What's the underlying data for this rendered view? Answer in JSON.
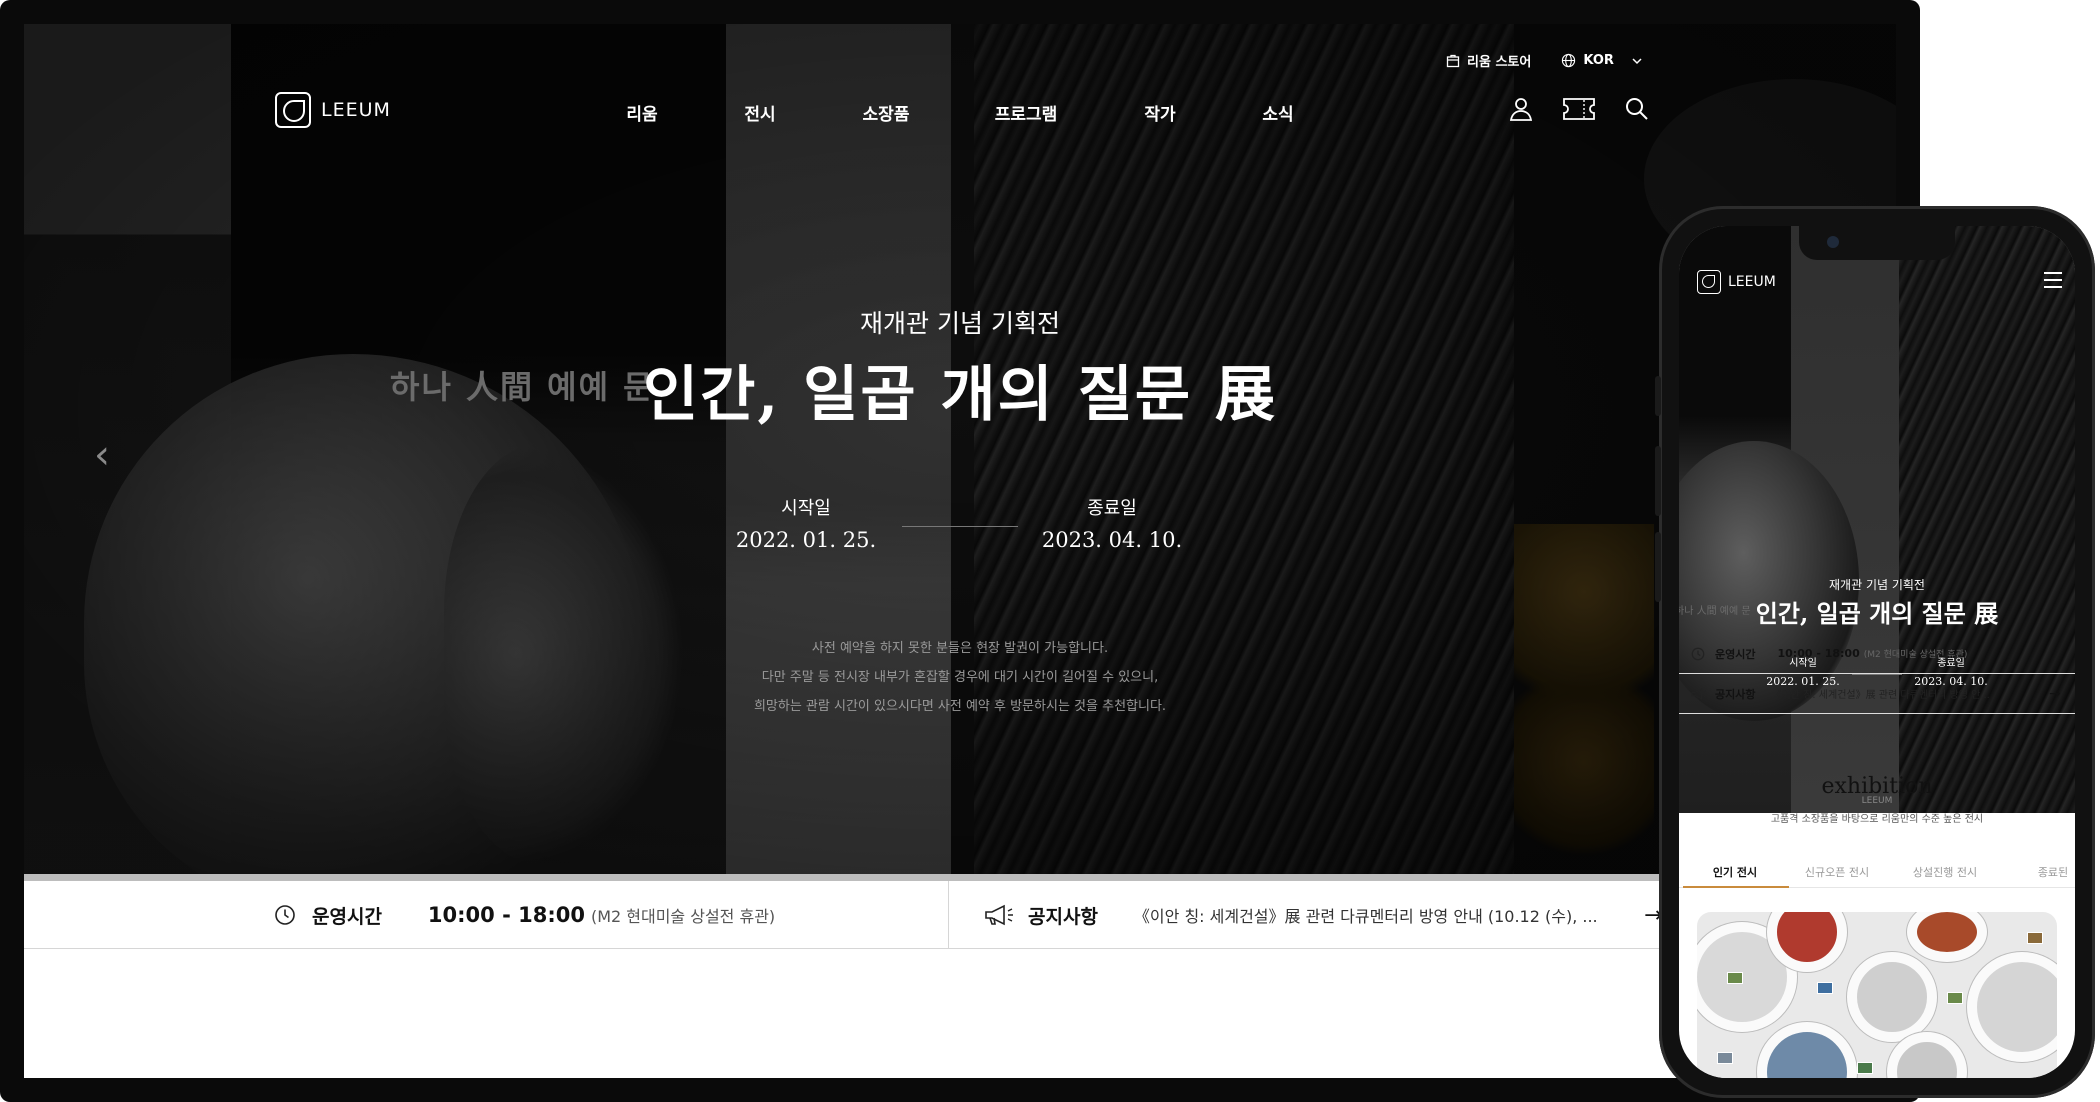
{
  "desktop": {
    "utility": {
      "store_label": "리움 스토어",
      "language_label": "KOR"
    },
    "logo_text": "LEEUM",
    "nav": [
      "리움",
      "전시",
      "소장품",
      "프로그램",
      "작가",
      "소식"
    ],
    "hero": {
      "ghost_text": "하나 人間 예예 문 ",
      "subtitle": "재개관 기념 기획전",
      "title": "인간, 일곱 개의 질문 展",
      "start_label": "시작일",
      "start_date": "2022. 01. 25.",
      "end_label": "종료일",
      "end_date": "2023. 04. 10.",
      "notice_lines": [
        "사전 예약을 하지 못한 분들은 현장 발권이 가능합니다.",
        "다만 주말 등 전시장 내부가 혼잡할 경우에 대기 시간이 길어질 수 있으니,",
        "희망하는 관람 시간이 있으시다면 사전 예약 후 방문하시는 것을 추천합니다."
      ]
    },
    "info_bar": {
      "hours_label": "운영시간",
      "hours_value": "10:00 - 18:00",
      "hours_note": "(M2 현대미술 상설전 휴관)",
      "notice_label": "공지사항",
      "notice_text": "《이안 칭: 세계건설》展 관련 다큐멘터리 방영 안내 (10.12 (수), ..."
    }
  },
  "mobile": {
    "logo_text": "LEEUM",
    "hero": {
      "ghost_text": "하나 人間 예예 문 ",
      "subtitle": "재개관 기념 기획전",
      "title": "인간, 일곱 개의 질문 展",
      "start_label": "시작일",
      "start_date": "2022. 01. 25.",
      "end_label": "종료일",
      "end_date": "2023. 04. 10.",
      "watermark": "LEEUM"
    },
    "hours_label": "운영시간",
    "hours_value": "10:00 - 18:00",
    "hours_note": "(M2 현대미술 상설전 휴관)",
    "notice_label": "공지사항",
    "notice_text": "《이안 칭: 세계건설》展 관련 다큐멘터리 방영 안...",
    "section_title": "exhibition",
    "section_subtitle": "고품격 소장품을 바탕으로 리움만의 수준 높은 전시",
    "tabs": [
      "인기 전시",
      "신규오픈 전시",
      "상설진행 전시",
      "종료된"
    ]
  },
  "colors": {
    "tab_accent": "#c98b3c",
    "hero_background": "#0b0b0b"
  }
}
